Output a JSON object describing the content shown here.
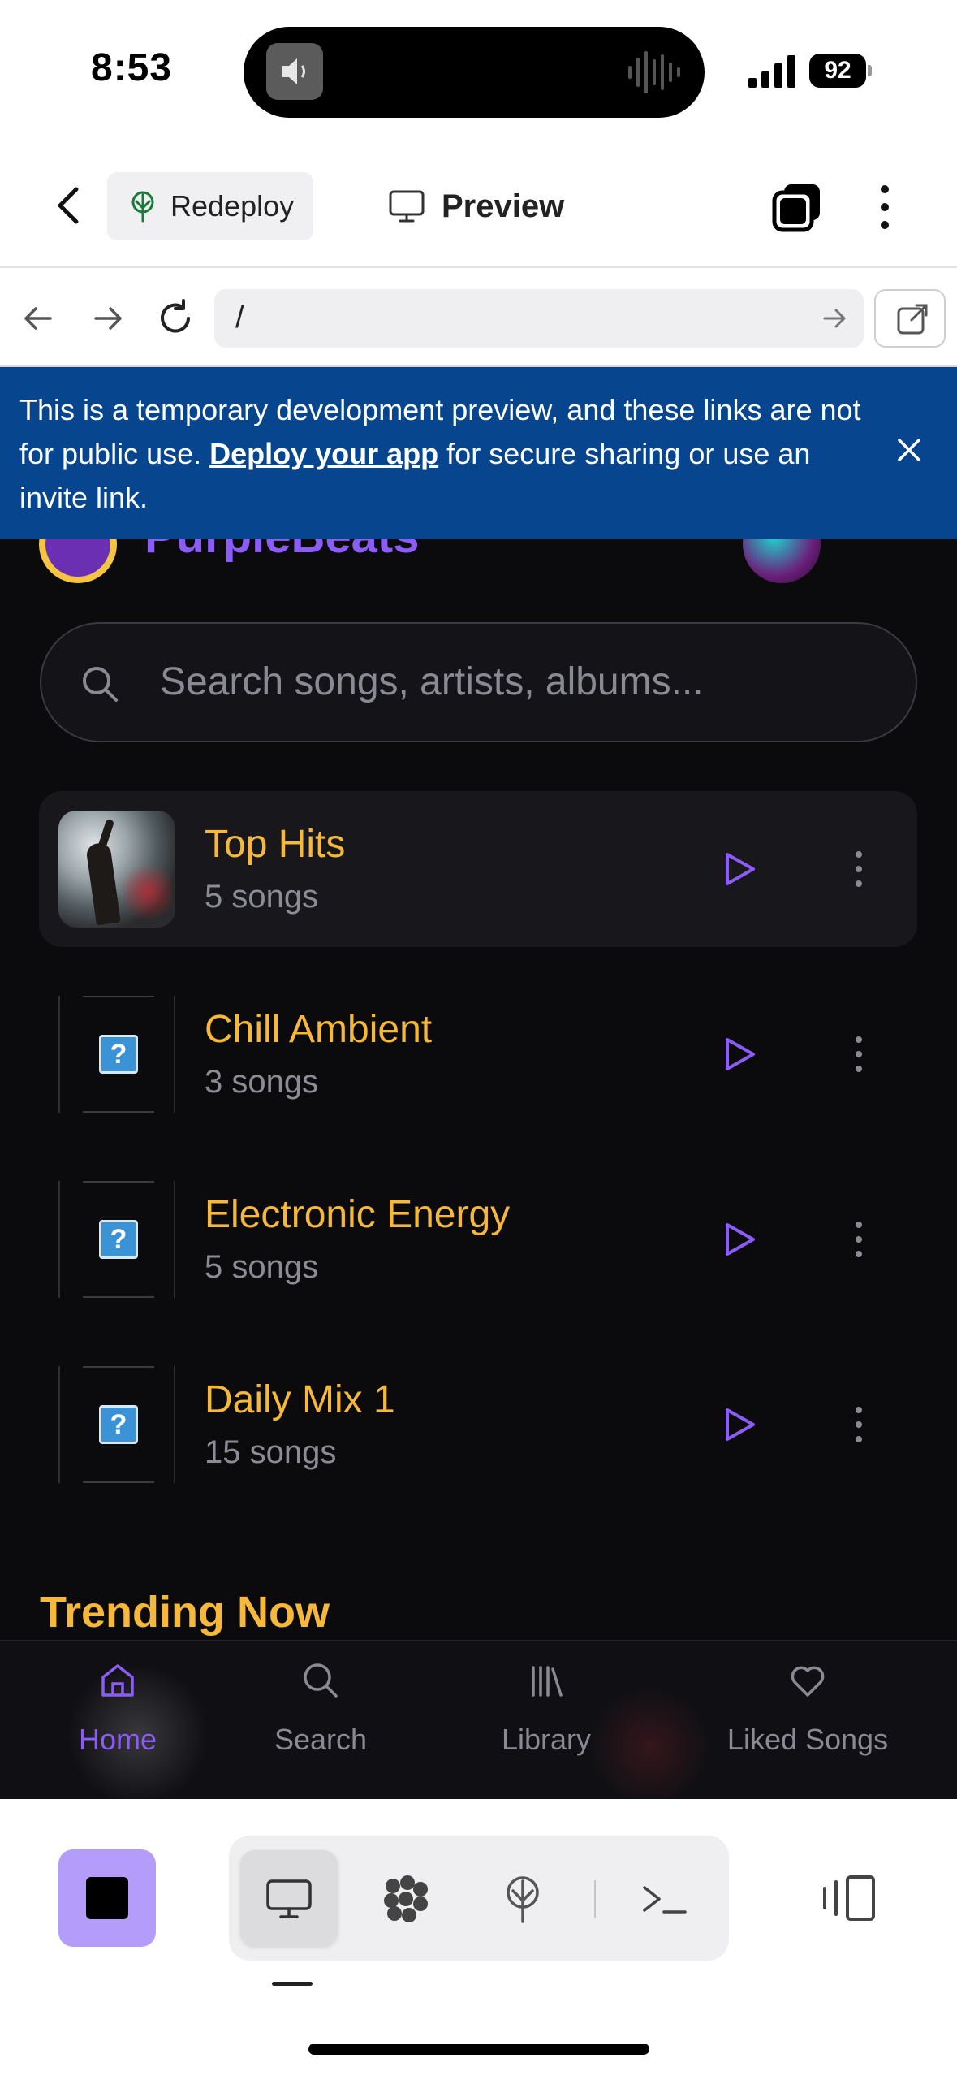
{
  "status": {
    "time": "8:53",
    "battery": "92"
  },
  "toolbar": {
    "redeploy_label": "Redeploy",
    "preview_label": "Preview"
  },
  "url_bar": {
    "path": "/"
  },
  "banner": {
    "text_before": "This is a temporary development preview, and these links are not for public use. ",
    "link": "Deploy your app",
    "text_after": " for secure sharing or use an invite link."
  },
  "app": {
    "brand": "PurpleBeats",
    "search_placeholder": "Search songs, artists, albums...",
    "playlists": [
      {
        "title": "Top Hits",
        "subtitle": "5 songs",
        "cover": "photo"
      },
      {
        "title": "Chill Ambient",
        "subtitle": "3 songs",
        "cover": "broken-image"
      },
      {
        "title": "Electronic Energy",
        "subtitle": "5 songs",
        "cover": "broken-image"
      },
      {
        "title": "Daily Mix 1",
        "subtitle": "15 songs",
        "cover": "broken-image"
      }
    ],
    "section_title": "Trending Now",
    "nav": [
      {
        "label": "Home",
        "icon": "home-icon",
        "active": true
      },
      {
        "label": "Search",
        "icon": "search-icon",
        "active": false
      },
      {
        "label": "Library",
        "icon": "library-icon",
        "active": false
      },
      {
        "label": "Liked Songs",
        "icon": "heart-icon",
        "active": false
      }
    ]
  },
  "colors": {
    "accent_purple": "#8b5cf6",
    "accent_gold": "#f5b83a",
    "banner_blue": "#07468f",
    "app_bg": "#0b0b0e"
  }
}
